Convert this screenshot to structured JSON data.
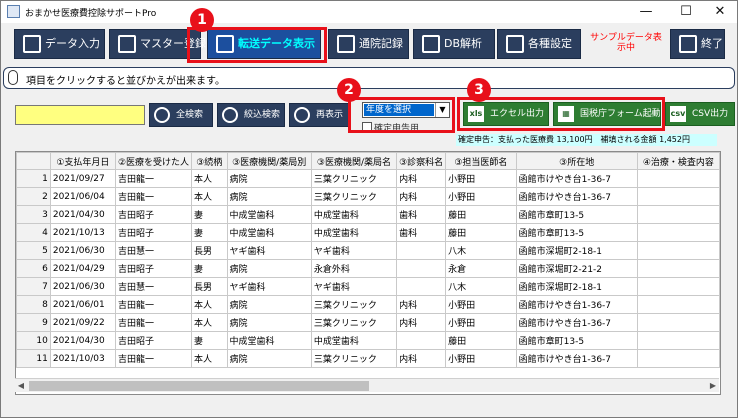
{
  "window": {
    "title": "おまかせ医療費控除サポートPro",
    "controls": {
      "minimize": "—",
      "maximize": "☐",
      "close": "✕"
    }
  },
  "toolbar": {
    "buttons": [
      {
        "label": "データ入力",
        "icon": "keyboard-icon"
      },
      {
        "label": "マスター登録",
        "icon": "person-icon"
      },
      {
        "label": "転送データ表示",
        "icon": "usb-icon"
      },
      {
        "label": "通院記録",
        "icon": "clipboard-icon"
      },
      {
        "label": "DB解析",
        "icon": "database-icon"
      },
      {
        "label": "各種設定",
        "icon": "list-icon"
      },
      {
        "label": "終了",
        "icon": "close-icon"
      }
    ],
    "sample_note": "サンプルデータ表示中"
  },
  "info_bar": {
    "text": "項目をクリックすると並びかえが出来ます。",
    "icon": "mouse-icon"
  },
  "search": {
    "value": "",
    "buttons": [
      {
        "label": "全検索",
        "icon": "search-icon"
      },
      {
        "label": "絞込検索",
        "icon": "search-plus-icon"
      },
      {
        "label": "再表示",
        "icon": "refresh-icon"
      }
    ]
  },
  "year_select": {
    "value": "年度を選択",
    "checkbox_label": "確定申告用"
  },
  "export_buttons": [
    {
      "label": "エクセル出力",
      "icon_text": "xls"
    },
    {
      "label": "国税庁フォーム起動",
      "icon_text": "▦"
    },
    {
      "label": "CSV出力",
      "icon_text": "csv"
    }
  ],
  "totals_text": "確定申告：支払った医療費 13,100円　補填される金額 1,452円",
  "callouts": [
    {
      "number": "1"
    },
    {
      "number": "2"
    },
    {
      "number": "3"
    }
  ],
  "table": {
    "columns": [
      "①支払年月日",
      "②医療を受けた人",
      "③続柄",
      "③医療機関/薬局別",
      "③医療機関/薬局名",
      "③診察科名",
      "③担当医師名",
      "③所在地",
      "④治療・検査内容"
    ],
    "rows": [
      {
        "n": "1",
        "cells": [
          "2021/09/27",
          "吉田龍一",
          "本人",
          "病院",
          "三葉クリニック",
          "内科",
          "小野田",
          "函館市けやき台1-36-7",
          ""
        ]
      },
      {
        "n": "2",
        "cells": [
          "2021/06/04",
          "吉田龍一",
          "本人",
          "病院",
          "三葉クリニック",
          "内科",
          "小野田",
          "函館市けやき台1-36-7",
          ""
        ]
      },
      {
        "n": "3",
        "cells": [
          "2021/04/30",
          "吉田昭子",
          "妻",
          "中成堂歯科",
          "中成堂歯科",
          "歯科",
          "藤田",
          "函館市章町13-5",
          ""
        ]
      },
      {
        "n": "4",
        "cells": [
          "2021/10/13",
          "吉田昭子",
          "妻",
          "中成堂歯科",
          "中成堂歯科",
          "歯科",
          "藤田",
          "函館市章町13-5",
          ""
        ]
      },
      {
        "n": "5",
        "cells": [
          "2021/06/30",
          "吉田慧一",
          "長男",
          "ヤギ歯科",
          "ヤギ歯科",
          "",
          "八木",
          "函館市深堀町2-18-1",
          ""
        ]
      },
      {
        "n": "6",
        "cells": [
          "2021/04/29",
          "吉田昭子",
          "妻",
          "病院",
          "永倉外科",
          "",
          "永倉",
          "函館市深堀町2-21-2",
          ""
        ]
      },
      {
        "n": "7",
        "cells": [
          "2021/06/30",
          "吉田慧一",
          "長男",
          "ヤギ歯科",
          "ヤギ歯科",
          "",
          "八木",
          "函館市深堀町2-18-1",
          ""
        ]
      },
      {
        "n": "8",
        "cells": [
          "2021/06/01",
          "吉田龍一",
          "本人",
          "病院",
          "三葉クリニック",
          "内科",
          "小野田",
          "函館市けやき台1-36-7",
          ""
        ]
      },
      {
        "n": "9",
        "cells": [
          "2021/09/22",
          "吉田龍一",
          "本人",
          "病院",
          "三葉クリニック",
          "内科",
          "小野田",
          "函館市けやき台1-36-7",
          ""
        ]
      },
      {
        "n": "10",
        "cells": [
          "2021/04/30",
          "吉田昭子",
          "妻",
          "中成堂歯科",
          "中成堂歯科",
          "",
          "藤田",
          "函館市章町13-5",
          ""
        ]
      },
      {
        "n": "11",
        "cells": [
          "2021/10/03",
          "吉田龍一",
          "本人",
          "病院",
          "三葉クリニック",
          "内科",
          "小野田",
          "函館市けやき台1-36-7",
          ""
        ]
      }
    ]
  },
  "scrollbar": {
    "left_arrow": "◀",
    "right_arrow": "▶"
  }
}
